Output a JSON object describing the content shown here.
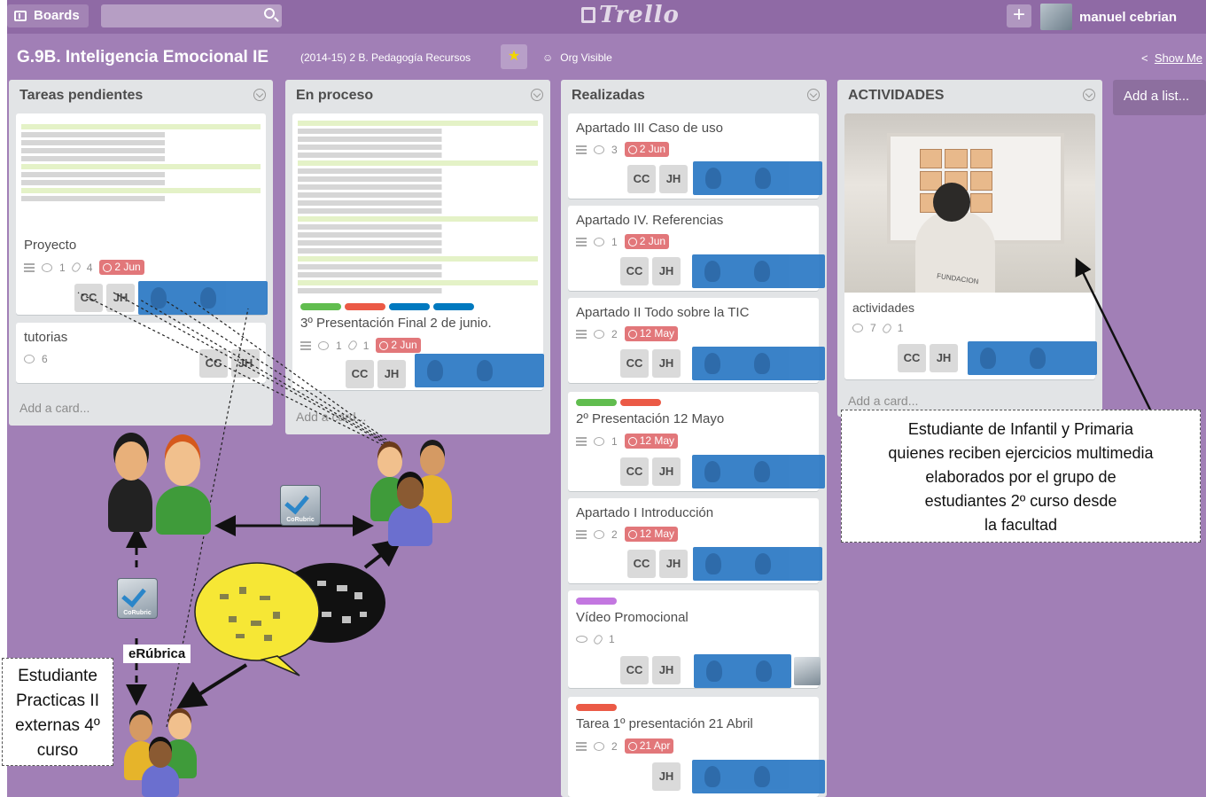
{
  "topbar": {
    "boards_label": "Boards",
    "logo": "Trello",
    "plus": "+",
    "user_name": "manuel cebrian"
  },
  "board": {
    "title": "G.9B. Inteligencia Emocional IE",
    "team": "(2014-15) 2 B. Pedagogía Recursos",
    "visibility": "Org Visible",
    "show_menu": "Show Me",
    "add_list": "Add a list..."
  },
  "lists": [
    {
      "name": "Tareas pendientes",
      "add_card": "Add a card...",
      "cards": [
        {
          "title": "Proyecto",
          "comments": "1",
          "attachments": "4",
          "due": "2 Jun",
          "members": [
            "CC",
            "JH"
          ]
        },
        {
          "title": "tutorias",
          "comments": "6",
          "members": [
            "CC",
            "JH"
          ]
        }
      ]
    },
    {
      "name": "En proceso",
      "add_card": "Add a card...",
      "cards": [
        {
          "title": "3º Presentación Final 2 de junio.",
          "comments": "1",
          "attachments": "1",
          "due": "2 Jun",
          "members": [
            "CC",
            "JH"
          ]
        }
      ]
    },
    {
      "name": "Realizadas",
      "add_card": "Add a card...",
      "cards": [
        {
          "title": "Apartado III Caso de uso",
          "comments": "3",
          "due": "2 Jun",
          "members": [
            "CC",
            "JH"
          ]
        },
        {
          "title": "Apartado IV. Referencias",
          "comments": "1",
          "due": "2 Jun",
          "members": [
            "CC",
            "JH"
          ]
        },
        {
          "title": "Apartado II Todo sobre la TIC",
          "comments": "2",
          "due": "12 May",
          "members": [
            "CC",
            "JH"
          ]
        },
        {
          "title": "2º Presentación 12 Mayo",
          "comments": "1",
          "due": "12 May",
          "members": [
            "CC",
            "JH"
          ]
        },
        {
          "title": "Apartado I Introducción",
          "comments": "2",
          "due": "12 May",
          "members": [
            "CC",
            "JH"
          ]
        },
        {
          "title": "Vídeo Promocional",
          "attachments": "1",
          "members": [
            "CC",
            "JH"
          ]
        },
        {
          "title": "Tarea 1º presentación 21 Abril",
          "comments": "2",
          "due": "21 Apr",
          "members": [
            "JH"
          ]
        }
      ]
    },
    {
      "name": "ACTIVIDADES",
      "add_card": "Add a card...",
      "cards": [
        {
          "title": "actividades",
          "comments": "7",
          "attachments": "1",
          "members": [
            "CC",
            "JH"
          ]
        }
      ]
    }
  ],
  "annotations": {
    "right_box": [
      "Estudiante de Infantil y Primaria",
      "quienes reciben ejercicios multimedia",
      "elaborados por el grupo de",
      "estudiantes 2º curso desde",
      "la facultad"
    ],
    "left_box": [
      "Estudiante",
      "Practicas II",
      "externas 4º",
      "curso"
    ],
    "erubrica": "eRúbrica",
    "corubric": "CoRubric",
    "photo_sign": "FUNDACION"
  },
  "colors": {
    "board_bg": "#a17fb6",
    "list_bg": "#e2e4e6",
    "label_green": "#61bd4f",
    "label_red": "#eb5a46",
    "label_blue": "#0079bf",
    "label_purple": "#c377e0",
    "due_red": "#e2777a",
    "member_highlight": "#2a78c4"
  }
}
